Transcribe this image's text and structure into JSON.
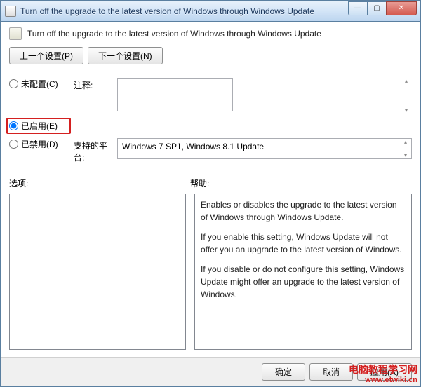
{
  "titlebar": {
    "title": "Turn off the upgrade to the latest version of Windows through Windows Update"
  },
  "header": {
    "title": "Turn off the upgrade to the latest version of Windows through Windows Update"
  },
  "nav": {
    "prev": "上一个设置(P)",
    "next": "下一个设置(N)"
  },
  "radios": {
    "not_configured": "未配置(C)",
    "enabled": "已启用(E)",
    "disabled": "已禁用(D)",
    "selected": "enabled"
  },
  "labels": {
    "comment": "注释:",
    "supported": "支持的平台:",
    "options": "选项:",
    "help": "帮助:"
  },
  "fields": {
    "comment_value": "",
    "supported_value": "Windows 7 SP1, Windows 8.1 Update"
  },
  "help": {
    "p1": "Enables or disables the upgrade to the latest version of Windows through Windows Update.",
    "p2": "If you enable this setting, Windows Update will not offer you an upgrade to the latest version of Windows.",
    "p3": "If you disable or do not configure this setting, Windows Update might offer an upgrade to the latest version of Windows."
  },
  "footer": {
    "ok": "确定",
    "cancel": "取消",
    "apply": "应用(A)"
  },
  "watermark": {
    "line1": "电脑教程学习网",
    "line2": "www.etwiki.cn"
  }
}
